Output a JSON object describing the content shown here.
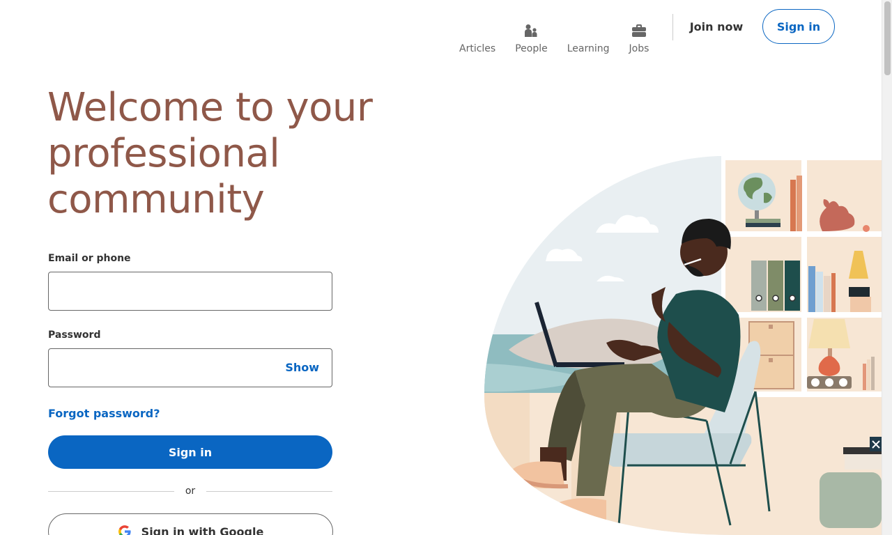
{
  "nav": {
    "items": [
      {
        "label": "Articles",
        "icon": "newspaper-icon"
      },
      {
        "label": "People",
        "icon": "people-icon"
      },
      {
        "label": "Learning",
        "icon": "learning-icon"
      },
      {
        "label": "Jobs",
        "icon": "briefcase-icon"
      }
    ],
    "join_label": "Join now",
    "signin_label": "Sign in"
  },
  "hero": {
    "title": "Welcome to your professional community"
  },
  "form": {
    "email_label": "Email or phone",
    "email_value": "",
    "password_label": "Password",
    "password_value": "",
    "show_label": "Show",
    "forgot_label": "Forgot password?",
    "signin_label": "Sign in",
    "or_label": "or",
    "google_label": "Sign in with Google"
  },
  "colors": {
    "brand_blue": "#0a66c2",
    "title_brown": "#8f5849"
  }
}
